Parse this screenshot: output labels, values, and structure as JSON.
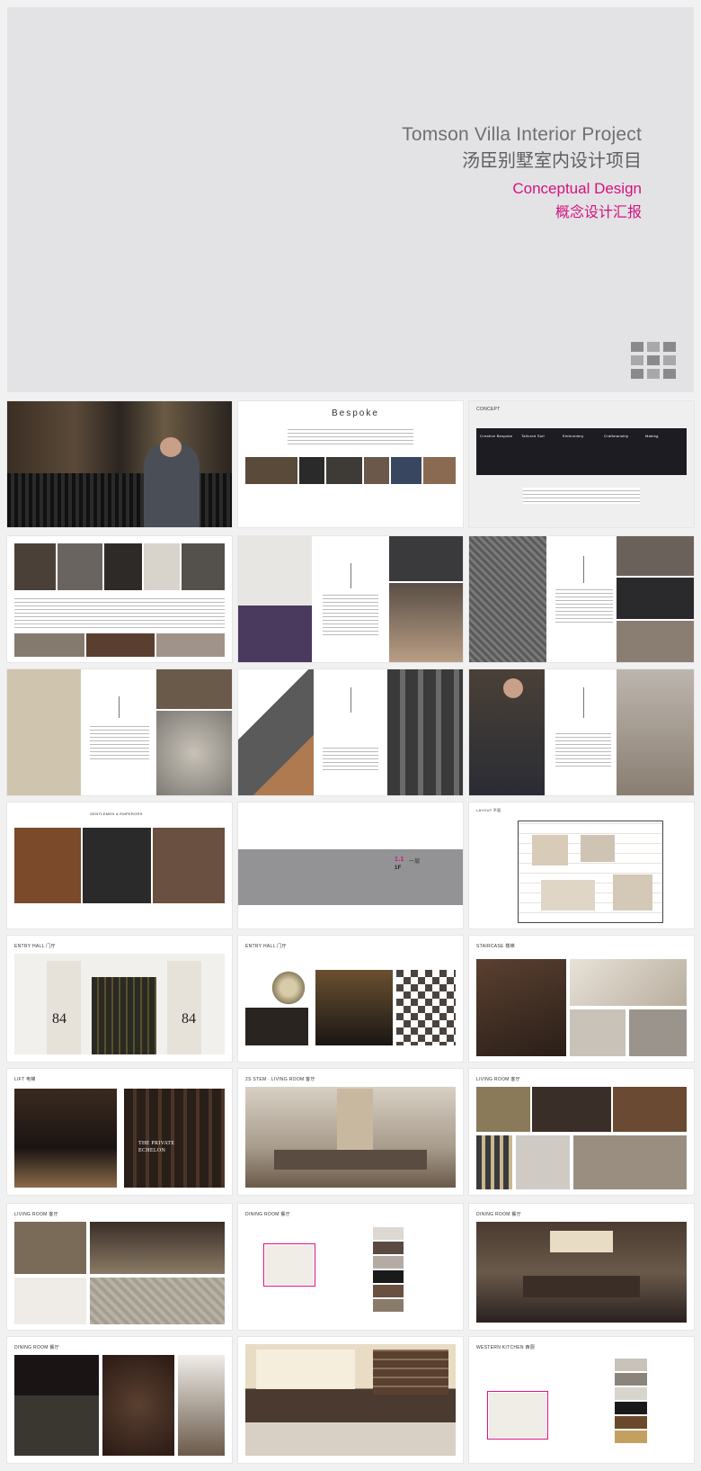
{
  "cover": {
    "title_en": "Tomson Villa Interior Project",
    "title_cn": "汤臣别墅室内设计项目",
    "subtitle_en": "Conceptual Design",
    "subtitle_cn": "概念设计汇报"
  },
  "pages": {
    "bespoke_title": "Bespoke",
    "concept_label": "CONCEPT",
    "concept_tiles": [
      "Creative Bespoke",
      "Tailored Suit",
      "Embroidery",
      "Craftmanship",
      "Making"
    ],
    "tailor_title": "GENTLEMEN & EMPERORS",
    "section_num": "1.1",
    "section_cn": "一层",
    "section_code": "1F",
    "layout_label": "LAYOUT 平面",
    "entry_hall": "ENTRY HALL 门厅",
    "entry_hall_2": "ENTRY HALL 门厅",
    "staircase": "STAIRCASE 楼梯",
    "lift": "LIFT 电梯",
    "living_2f": "2S STEM · LIVING ROOM 客厅",
    "living_room": "LIVING ROOM 客厅",
    "living_room_2": "LIVING ROOM 客厅",
    "dining_room": "DINING ROOM 餐厅",
    "dining_room_2": "DINING ROOM 餐厅",
    "dining_room_3": "DINING ROOM 餐厅",
    "western_kitchen": "WESTERN KITCHEN 西厨",
    "door_number": "84",
    "lift_text_1": "THE PRIVATE",
    "lift_text_2": "ECHELON"
  },
  "colors": {
    "accent": "#d4127d",
    "cover_bg": "#e3e3e5"
  }
}
